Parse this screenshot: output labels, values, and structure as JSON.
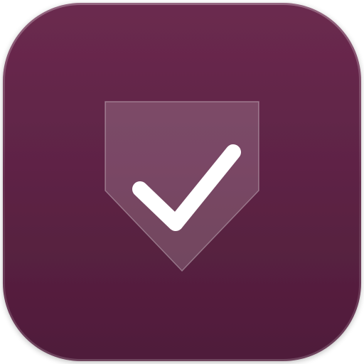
{
  "app_icon": {
    "icon": "shield-check-icon",
    "colors": {
      "tile_top": "#6b2a4f",
      "tile_bottom": "#4f1c3a",
      "tile_rim": "#8a5a76",
      "shield_fill": "#ffffff",
      "checkmark": "#ffffff"
    }
  }
}
